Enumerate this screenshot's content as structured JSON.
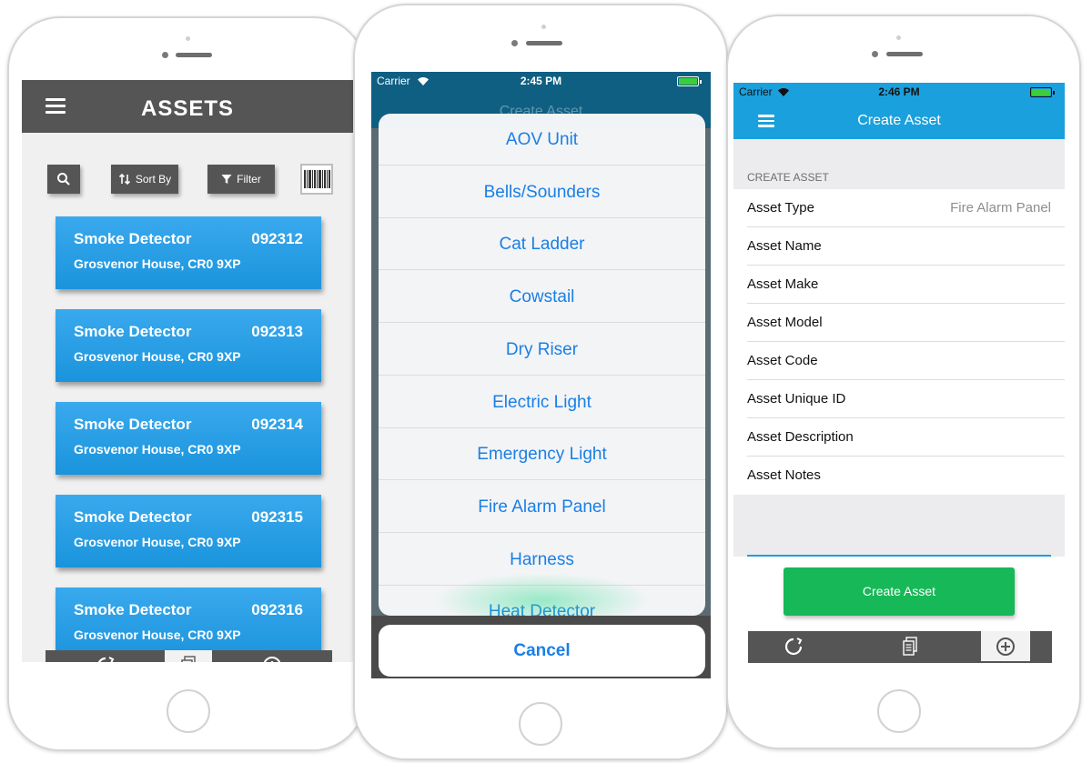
{
  "phone1": {
    "header": {
      "title": "ASSETS"
    },
    "toolbar": {
      "sort_label": "Sort By",
      "filter_label": "Filter"
    },
    "assets": [
      {
        "name": "Smoke Detector",
        "code": "092312",
        "address": "Grosvenor House, CR0 9XP"
      },
      {
        "name": "Smoke Detector",
        "code": "092313",
        "address": "Grosvenor House, CR0 9XP"
      },
      {
        "name": "Smoke Detector",
        "code": "092314",
        "address": "Grosvenor House, CR0 9XP"
      },
      {
        "name": "Smoke Detector",
        "code": "092315",
        "address": "Grosvenor House, CR0 9XP"
      },
      {
        "name": "Smoke Detector",
        "code": "092316",
        "address": "Grosvenor House, CR0 9XP"
      }
    ],
    "tabbar": {
      "icons": [
        "sync-icon",
        "documents-icon",
        "add-circle-icon"
      ],
      "active": "documents-icon"
    }
  },
  "phone2": {
    "status": {
      "carrier": "Carrier",
      "time": "2:45 PM"
    },
    "background_title": "Create Asset",
    "sheet": {
      "options": [
        "AOV Unit",
        "Bells/Sounders",
        "Cat Ladder",
        "Cowstail",
        "Dry Riser",
        "Electric Light",
        "Emergency Light",
        "Fire Alarm Panel",
        "Harness",
        "Heat Detector"
      ],
      "cancel_label": "Cancel"
    }
  },
  "phone3": {
    "status": {
      "carrier": "Carrier",
      "time": "2:46 PM"
    },
    "header": {
      "title": "Create Asset"
    },
    "section_label": "CREATE ASSET",
    "fields": [
      {
        "label": "Asset Type",
        "value": "Fire Alarm Panel"
      },
      {
        "label": "Asset Name",
        "value": ""
      },
      {
        "label": "Asset Make",
        "value": ""
      },
      {
        "label": "Asset Model",
        "value": ""
      },
      {
        "label": "Asset Code",
        "value": ""
      },
      {
        "label": "Asset Unique ID",
        "value": ""
      },
      {
        "label": "Asset Description",
        "value": ""
      },
      {
        "label": "Asset Notes",
        "value": ""
      }
    ],
    "create_button_label": "Create Asset",
    "tabbar": {
      "icons": [
        "sync-icon",
        "documents-icon",
        "add-circle-icon"
      ],
      "active": "add-circle-icon"
    }
  },
  "colors": {
    "dark_gray": "#555555",
    "card_blue": "#1a94dc",
    "header_blue": "#1aa0dd",
    "ios_blue": "#1a7fe6",
    "button_green": "#17b857"
  }
}
